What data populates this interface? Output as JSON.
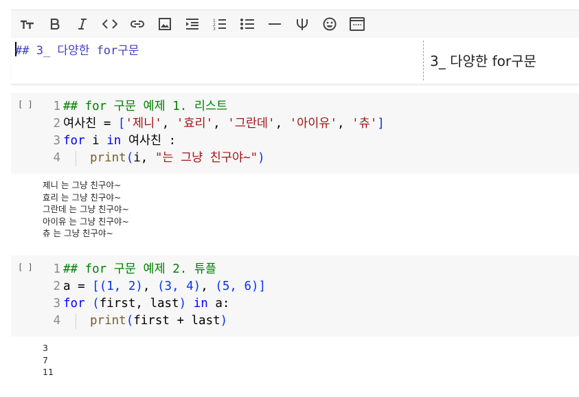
{
  "toolbar": {
    "items": [
      {
        "name": "text-size-icon"
      },
      {
        "name": "bold-icon"
      },
      {
        "name": "italic-icon"
      },
      {
        "name": "code-icon"
      },
      {
        "name": "link-icon"
      },
      {
        "name": "image-icon"
      },
      {
        "name": "indent-icon"
      },
      {
        "name": "numbered-list-icon"
      },
      {
        "name": "bulleted-list-icon"
      },
      {
        "name": "horizontal-rule-icon"
      },
      {
        "name": "psi-icon"
      },
      {
        "name": "emoji-icon"
      },
      {
        "name": "preview-toggle-icon"
      }
    ]
  },
  "text_cell": {
    "markdown_source": "## 3_ 다양한 for구문",
    "preview_text": "3_ 다양한 for구문"
  },
  "cell1": {
    "run_label": "[ ]",
    "line_numbers": [
      "1",
      "2",
      "3",
      "4"
    ],
    "line1": "## for 구문 예제 1. 리스트",
    "line2": {
      "var": "여사친 ",
      "eq": "= ",
      "open": "[",
      "s1": "'제니'",
      "c1": ", ",
      "s2": "'효리'",
      "c2": ", ",
      "s3": "'그란데'",
      "c3": ", ",
      "s4": "'아이유'",
      "c4": ", ",
      "s5": "'츄'",
      "close": "]"
    },
    "line3": {
      "kw1": "for",
      "v": " i ",
      "kw2": "in",
      "rest": " 여사친 :"
    },
    "line4": {
      "fn": "print",
      "open": "(",
      "arg": "i, ",
      "str": "\"는 그냥 친구야~\"",
      "close": ")"
    },
    "output": "제니 는 그냥 친구야~\n효리 는 그냥 친구야~\n그란데 는 그냥 친구야~\n아이유 는 그냥 친구야~\n츄 는 그냥 친구야~"
  },
  "cell2": {
    "run_label": "[ ]",
    "line_numbers": [
      "1",
      "2",
      "3",
      "4"
    ],
    "line1": "## for 구문 예제 2. 튜플",
    "line2": {
      "var": "a = ",
      "open": "[",
      "t1": "(1, 2)",
      "c1": ", ",
      "t2": "(3, 4)",
      "c2": ", ",
      "t3": "(5, 6)",
      "close": "]"
    },
    "line3": {
      "kw1": "for",
      "sp": " ",
      "open": "(",
      "args": "first, last",
      "close": ")",
      "sp2": " ",
      "kw2": "in",
      "rest": " a:"
    },
    "line4": {
      "fn": "print",
      "open": "(",
      "arg": "first + last",
      "close": ")"
    },
    "output": "3\n7\n11"
  }
}
